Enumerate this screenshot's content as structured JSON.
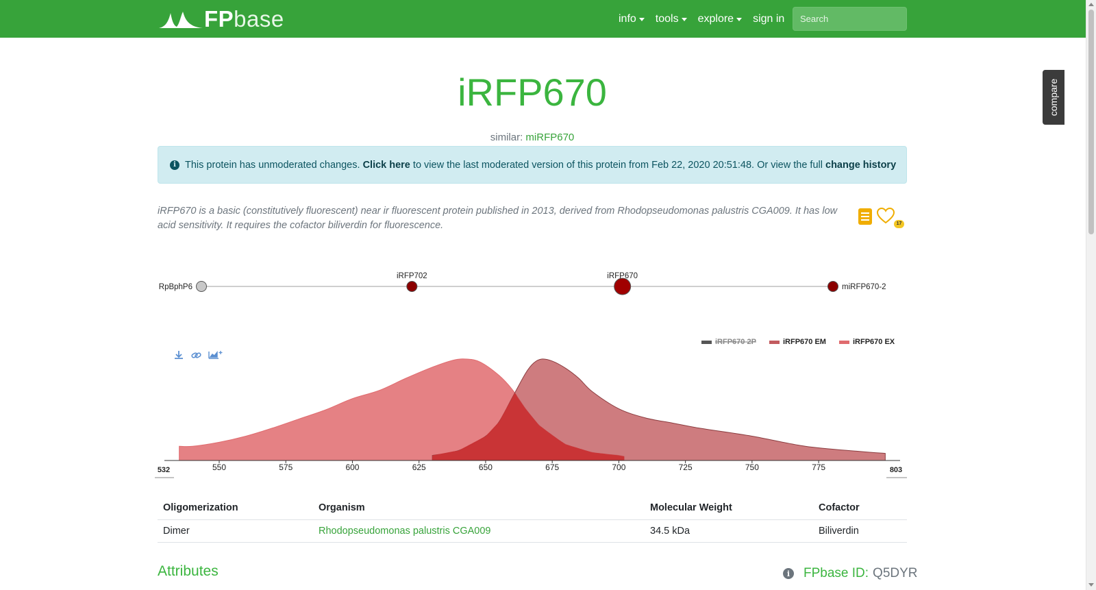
{
  "nav": {
    "brand_fp": "FP",
    "brand_base": "base",
    "items": [
      {
        "label": "info",
        "dropdown": true
      },
      {
        "label": "tools",
        "dropdown": true
      },
      {
        "label": "explore",
        "dropdown": true
      },
      {
        "label": "sign in",
        "dropdown": false
      }
    ],
    "search_placeholder": "Search"
  },
  "compare_tab": "compare",
  "protein": {
    "name": "iRFP670",
    "similar_label": "similar:",
    "similar_link": "miRFP670"
  },
  "alert": {
    "text1": "This protein has unmoderated changes.",
    "click_here": "Click here",
    "text2": "to view the last moderated version of this protein from Feb 22, 2020 20:51:48. Or view the full",
    "change_history": "change history"
  },
  "description": "iRFP670 is a basic (constitutively fluorescent) near ir fluorescent protein published in 2013, derived from Rhodopseudomonas palustris CGA009. It has low acid sensitivity. It requires the cofactor biliverdin for fluorescence.",
  "favorite_count": "17",
  "lineage": {
    "nodes": [
      {
        "name": "RpBphP6",
        "label_side": "left",
        "color": "#c8c8c8",
        "current": false
      },
      {
        "name": "iRFP702",
        "label_side": "top",
        "color": "#8b0000",
        "current": false
      },
      {
        "name": "iRFP670",
        "label_side": "top",
        "color": "#a00000",
        "current": true
      },
      {
        "name": "miRFP670-2",
        "label_side": "right",
        "color": "#8b0000",
        "current": false
      }
    ]
  },
  "chart_data": {
    "type": "area",
    "xlabel": "",
    "ylabel": "",
    "xlim": [
      532,
      803
    ],
    "ylim": [
      0,
      1
    ],
    "x_ticks": [
      550,
      575,
      600,
      625,
      650,
      675,
      700,
      725,
      750,
      775
    ],
    "range_labels": [
      "532",
      "803"
    ],
    "legend_position": "top-right",
    "series": [
      {
        "name": "iRFP670 2P",
        "color": "#555555",
        "hidden": true,
        "points": []
      },
      {
        "name": "iRFP670 EM",
        "color": "#c25b5f",
        "hidden": false,
        "points": [
          [
            630,
            0.05
          ],
          [
            640,
            0.1
          ],
          [
            650,
            0.24
          ],
          [
            655,
            0.38
          ],
          [
            660,
            0.62
          ],
          [
            665,
            0.86
          ],
          [
            668,
            0.96
          ],
          [
            671,
            1.0
          ],
          [
            675,
            0.98
          ],
          [
            680,
            0.91
          ],
          [
            685,
            0.81
          ],
          [
            690,
            0.68
          ],
          [
            700,
            0.51
          ],
          [
            710,
            0.42
          ],
          [
            720,
            0.37
          ],
          [
            730,
            0.32
          ],
          [
            750,
            0.24
          ],
          [
            770,
            0.14
          ],
          [
            790,
            0.09
          ],
          [
            800,
            0.07
          ]
        ]
      },
      {
        "name": "iRFP670 EX",
        "color": "#e06b6e",
        "hidden": false,
        "points": [
          [
            535,
            0.14
          ],
          [
            540,
            0.14
          ],
          [
            550,
            0.18
          ],
          [
            560,
            0.24
          ],
          [
            570,
            0.32
          ],
          [
            580,
            0.41
          ],
          [
            590,
            0.5
          ],
          [
            600,
            0.61
          ],
          [
            610,
            0.69
          ],
          [
            620,
            0.81
          ],
          [
            630,
            0.92
          ],
          [
            638,
            0.99
          ],
          [
            643,
            1.0
          ],
          [
            648,
            0.97
          ],
          [
            655,
            0.84
          ],
          [
            660,
            0.7
          ],
          [
            665,
            0.51
          ],
          [
            670,
            0.35
          ],
          [
            675,
            0.25
          ],
          [
            680,
            0.16
          ],
          [
            690,
            0.08
          ],
          [
            700,
            0.05
          ],
          [
            702,
            0.04
          ]
        ]
      }
    ]
  },
  "table": {
    "headers": [
      "Oligomerization",
      "Organism",
      "Molecular Weight",
      "Cofactor"
    ],
    "row": [
      "Dimer",
      "Rhodopseudomonas palustris CGA009",
      "34.5 kDa",
      "Biliverdin"
    ]
  },
  "sections": {
    "attributes": "Attributes",
    "fpbase_id_label": "FPbase ID:",
    "fpbase_id_value": "Q5DYR"
  }
}
